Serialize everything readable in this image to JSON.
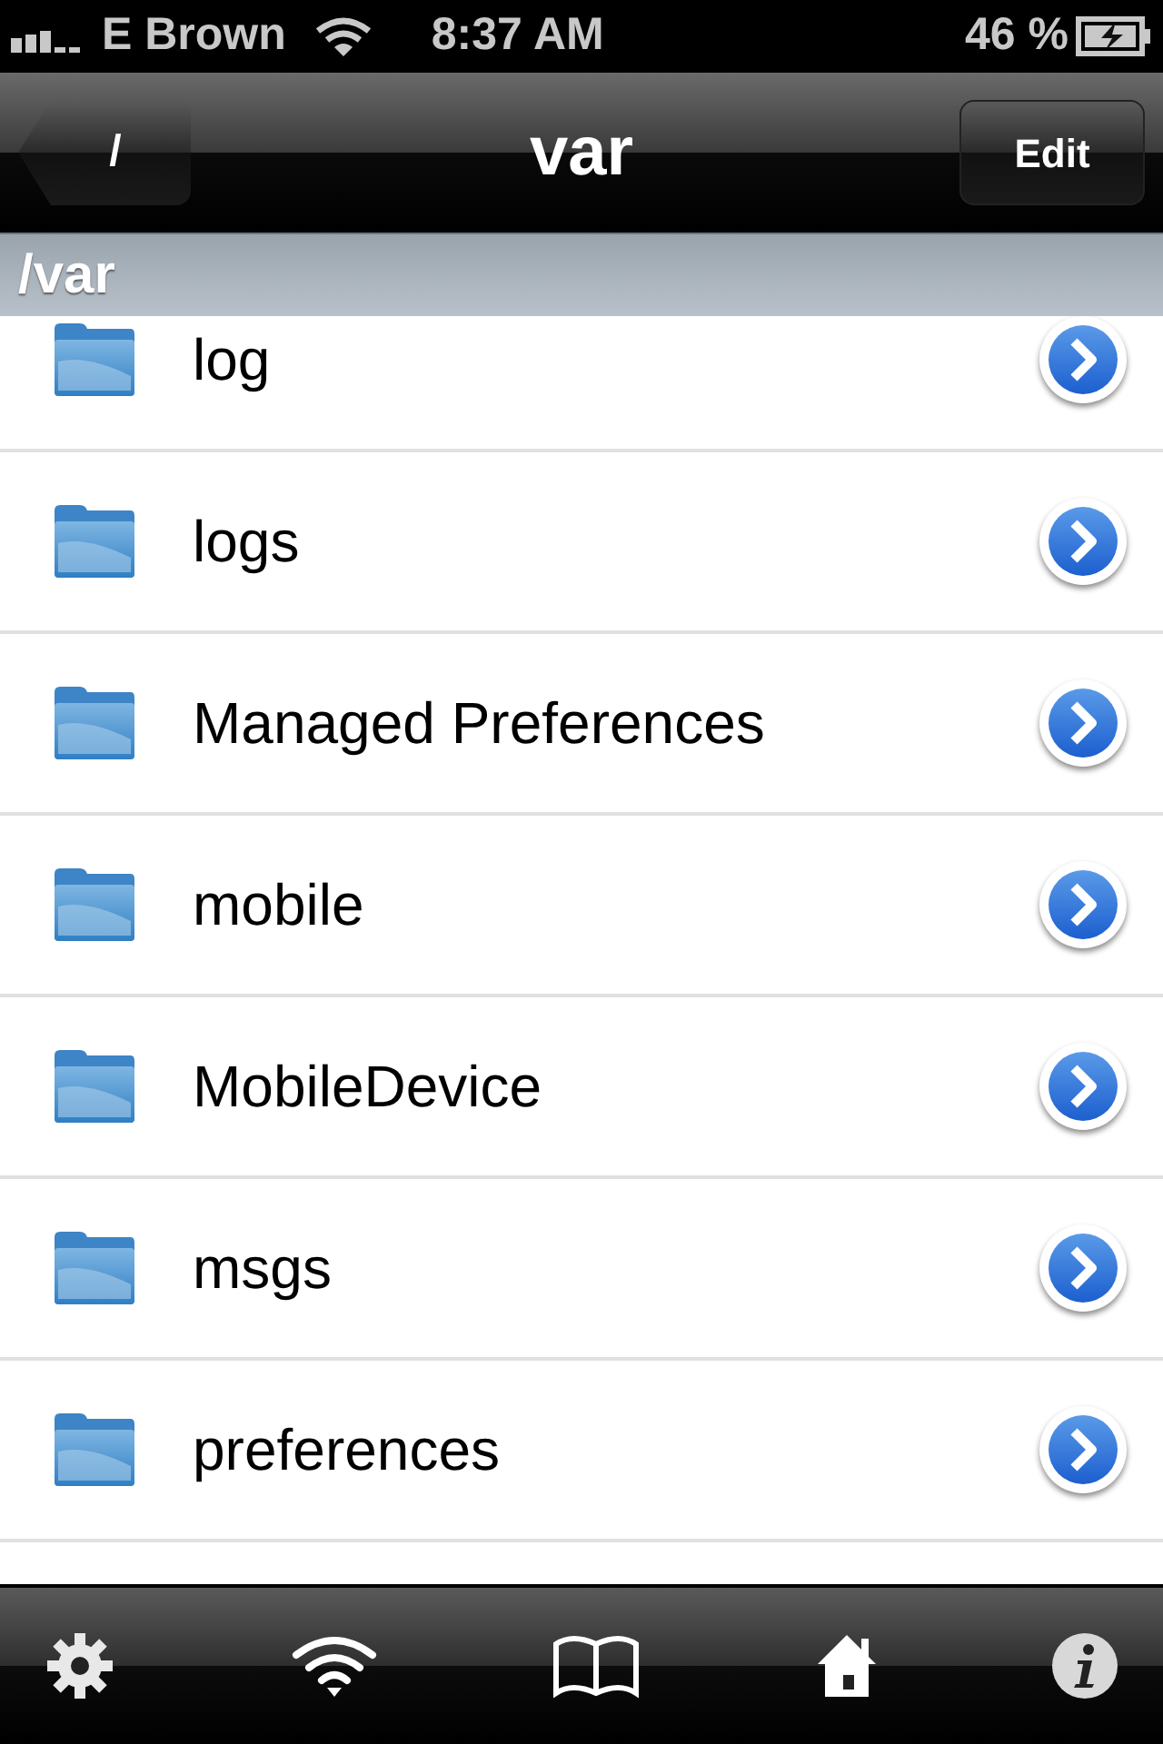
{
  "status_bar": {
    "carrier": "E Brown",
    "time": "8:37 AM",
    "battery": "46 %"
  },
  "nav_bar": {
    "back": "/",
    "title": "var",
    "edit": "Edit"
  },
  "section_header": "/var",
  "items": [
    {
      "name": "log"
    },
    {
      "name": "logs"
    },
    {
      "name": "Managed Preferences"
    },
    {
      "name": "mobile"
    },
    {
      "name": "MobileDevice"
    },
    {
      "name": "msgs"
    },
    {
      "name": "preferences"
    }
  ],
  "tab_bar": [
    {
      "kind": "settings"
    },
    {
      "kind": "wifi"
    },
    {
      "kind": "book"
    },
    {
      "kind": "home"
    },
    {
      "kind": "info"
    }
  ]
}
